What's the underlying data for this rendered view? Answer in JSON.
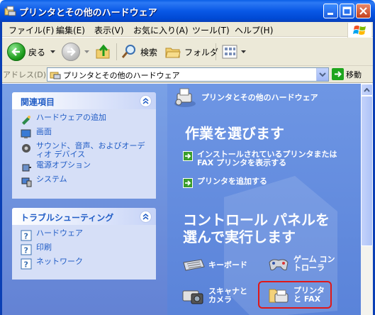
{
  "window": {
    "title": "プリンタとその他のハードウェア"
  },
  "menu": {
    "items": [
      "ファイル(F)",
      "編集(E)",
      "表示(V)",
      "お気に入り(A)",
      "ツール(T)",
      "ヘルプ(H)"
    ]
  },
  "toolbar": {
    "back_label": "戻る",
    "search_label": "検索",
    "folder_label": "フォルダ"
  },
  "address": {
    "label": "アドレス(D)",
    "value": "プリンタとその他のハードウェア",
    "go_label": "移動"
  },
  "sidebar": {
    "related": {
      "title": "関連項目",
      "items": [
        {
          "label": "ハードウェアの追加",
          "icon": "hardware-wizard-icon"
        },
        {
          "label": "画面",
          "icon": "display-icon"
        },
        {
          "label": "サウンド、音声、およびオーディオ デバイス",
          "icon": "sound-icon"
        },
        {
          "label": "電源オプション",
          "icon": "power-icon"
        },
        {
          "label": "システム",
          "icon": "system-icon"
        }
      ]
    },
    "troubleshoot": {
      "title": "トラブルシューティング",
      "items": [
        {
          "label": "ハードウェア",
          "icon": "help-icon"
        },
        {
          "label": "印刷",
          "icon": "help-icon"
        },
        {
          "label": "ネットワーク",
          "icon": "help-icon"
        }
      ]
    }
  },
  "main": {
    "header": "プリンタとその他のハードウェア",
    "task_heading": "作業を選びます",
    "tasks": [
      "インストールされているプリンタまたは FAX プリンタを表示する",
      "プリンタを追加する"
    ],
    "cp_heading_line1": "コントロール パネルを",
    "cp_heading_line2": "選んで実行します",
    "categories": [
      {
        "label": "キーボード",
        "icon": "keyboard-icon"
      },
      {
        "label": "ゲーム コントローラ",
        "icon": "game-controller-icon"
      },
      {
        "label": "スキャナとカメラ",
        "icon": "scanner-camera-icon"
      },
      {
        "label": "プリンタと FAX",
        "icon": "printer-fax-icon"
      }
    ]
  },
  "colors": {
    "title_blue": "#0a5fe6",
    "link_blue": "#215dc6",
    "highlight_red": "#e01818"
  }
}
